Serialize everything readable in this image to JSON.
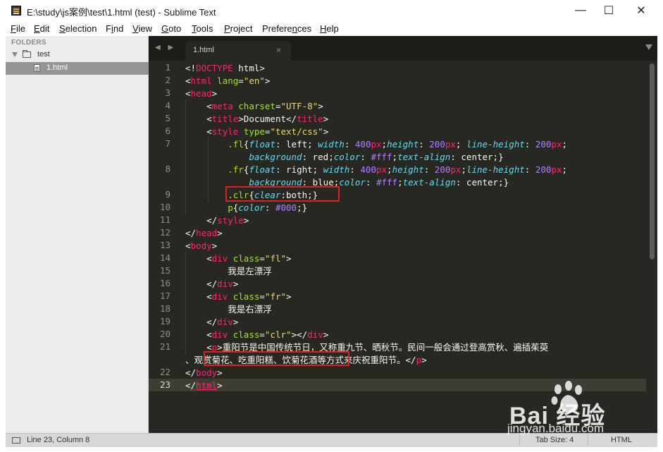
{
  "window": {
    "title": "E:\\study\\js案例\\test\\1.html (test) - Sublime Text",
    "controls": {
      "minimize": "—",
      "maximize": "☐",
      "close": "✕"
    }
  },
  "menu": [
    {
      "pre": "",
      "mn": "F",
      "post": "ile"
    },
    {
      "pre": "",
      "mn": "E",
      "post": "dit"
    },
    {
      "pre": "",
      "mn": "S",
      "post": "election"
    },
    {
      "pre": "F",
      "mn": "i",
      "post": "nd"
    },
    {
      "pre": "",
      "mn": "V",
      "post": "iew"
    },
    {
      "pre": "",
      "mn": "G",
      "post": "oto"
    },
    {
      "pre": "",
      "mn": "T",
      "post": "ools"
    },
    {
      "pre": "",
      "mn": "P",
      "post": "roject"
    },
    {
      "pre": "Prefere",
      "mn": "n",
      "post": "ces"
    },
    {
      "pre": "",
      "mn": "H",
      "post": "elp"
    }
  ],
  "sidebar": {
    "header": "FOLDERS",
    "folder": "test",
    "file": "1.html"
  },
  "tabs": {
    "nav": "◀ ▶",
    "active_tab": "1.html",
    "close": "×"
  },
  "editor": {
    "line_numbers": [
      "1",
      "2",
      "3",
      "4",
      "5",
      "6",
      "7",
      "",
      "8",
      "",
      "9",
      "10",
      "11",
      "12",
      "13",
      "14",
      "15",
      "16",
      "17",
      "18",
      "19",
      "20",
      "21",
      "",
      "22",
      "23"
    ],
    "active_line": "23",
    "code": [
      [
        [
          "t",
          "<!"
        ],
        [
          "k",
          "DOCTYPE"
        ],
        [
          "t",
          " html>"
        ]
      ],
      [
        [
          "t",
          "<"
        ],
        [
          "k",
          "html"
        ],
        [
          "t",
          " "
        ],
        [
          "a",
          "lang"
        ],
        [
          "t",
          "="
        ],
        [
          "s",
          "\"en\""
        ],
        [
          "t",
          ">"
        ]
      ],
      [
        [
          "t",
          "<"
        ],
        [
          "k",
          "head"
        ],
        [
          "t",
          ">"
        ]
      ],
      [
        [
          "t",
          "    <"
        ],
        [
          "k",
          "meta"
        ],
        [
          "t",
          " "
        ],
        [
          "a",
          "charset"
        ],
        [
          "t",
          "="
        ],
        [
          "s",
          "\"UTF-8\""
        ],
        [
          "t",
          ">"
        ]
      ],
      [
        [
          "t",
          "    <"
        ],
        [
          "k",
          "title"
        ],
        [
          "t",
          ">Document</"
        ],
        [
          "k",
          "title"
        ],
        [
          "t",
          ">"
        ]
      ],
      [
        [
          "t",
          "    <"
        ],
        [
          "k",
          "style"
        ],
        [
          "t",
          " "
        ],
        [
          "a",
          "type"
        ],
        [
          "t",
          "="
        ],
        [
          "s",
          "\"text/css\""
        ],
        [
          "t",
          ">"
        ]
      ],
      [
        [
          "t",
          "        "
        ],
        [
          "a",
          ".fl"
        ],
        [
          "t",
          "{"
        ],
        [
          "p",
          "float"
        ],
        [
          "t",
          ": left; "
        ],
        [
          "p",
          "width"
        ],
        [
          "t",
          ": "
        ],
        [
          "n",
          "400"
        ],
        [
          "k",
          "px"
        ],
        [
          "t",
          ";"
        ],
        [
          "p",
          "height"
        ],
        [
          "t",
          ": "
        ],
        [
          "n",
          "200"
        ],
        [
          "k",
          "px"
        ],
        [
          "t",
          "; "
        ],
        [
          "p",
          "line-height"
        ],
        [
          "t",
          ": "
        ],
        [
          "n",
          "200"
        ],
        [
          "k",
          "px"
        ],
        [
          "t",
          ";"
        ]
      ],
      [
        [
          "t",
          "            "
        ],
        [
          "p",
          "background"
        ],
        [
          "t",
          ": red;"
        ],
        [
          "p",
          "color"
        ],
        [
          "t",
          ": "
        ],
        [
          "n",
          "#fff"
        ],
        [
          "t",
          ";"
        ],
        [
          "p",
          "text-align"
        ],
        [
          "t",
          ": center;}"
        ]
      ],
      [
        [
          "t",
          "        "
        ],
        [
          "a",
          ".fr"
        ],
        [
          "t",
          "{"
        ],
        [
          "p",
          "float"
        ],
        [
          "t",
          ": right; "
        ],
        [
          "p",
          "width"
        ],
        [
          "t",
          ": "
        ],
        [
          "n",
          "400"
        ],
        [
          "k",
          "px"
        ],
        [
          "t",
          ";"
        ],
        [
          "p",
          "height"
        ],
        [
          "t",
          ": "
        ],
        [
          "n",
          "200"
        ],
        [
          "k",
          "px"
        ],
        [
          "t",
          ";"
        ],
        [
          "p",
          "line-height"
        ],
        [
          "t",
          ": "
        ],
        [
          "n",
          "200"
        ],
        [
          "k",
          "px"
        ],
        [
          "t",
          ";"
        ]
      ],
      [
        [
          "t",
          "            "
        ],
        [
          "p",
          "background"
        ],
        [
          "t",
          ": blue;"
        ],
        [
          "p",
          "color"
        ],
        [
          "t",
          ": "
        ],
        [
          "n",
          "#fff"
        ],
        [
          "t",
          ";"
        ],
        [
          "p",
          "text-align"
        ],
        [
          "t",
          ": center;}"
        ]
      ],
      [
        [
          "t",
          "        "
        ],
        [
          "a",
          ".clr"
        ],
        [
          "t",
          "{"
        ],
        [
          "p",
          "clear"
        ],
        [
          "t",
          ":both;}"
        ]
      ],
      [
        [
          "t",
          "        "
        ],
        [
          "a",
          "p"
        ],
        [
          "t",
          "{"
        ],
        [
          "p",
          "color"
        ],
        [
          "t",
          ": "
        ],
        [
          "n",
          "#000"
        ],
        [
          "t",
          ";}"
        ]
      ],
      [
        [
          "t",
          "    </"
        ],
        [
          "k",
          "style"
        ],
        [
          "t",
          ">"
        ]
      ],
      [
        [
          "t",
          "</"
        ],
        [
          "k",
          "head"
        ],
        [
          "t",
          ">"
        ]
      ],
      [
        [
          "t",
          "<"
        ],
        [
          "k",
          "body"
        ],
        [
          "t",
          ">"
        ]
      ],
      [
        [
          "t",
          "    <"
        ],
        [
          "k",
          "div"
        ],
        [
          "t",
          " "
        ],
        [
          "a",
          "class"
        ],
        [
          "t",
          "="
        ],
        [
          "s",
          "\"fl\""
        ],
        [
          "t",
          ">"
        ]
      ],
      [
        [
          "t",
          "        我是左漂浮"
        ]
      ],
      [
        [
          "t",
          "    </"
        ],
        [
          "k",
          "div"
        ],
        [
          "t",
          ">"
        ]
      ],
      [
        [
          "t",
          "    <"
        ],
        [
          "k",
          "div"
        ],
        [
          "t",
          " "
        ],
        [
          "a",
          "class"
        ],
        [
          "t",
          "="
        ],
        [
          "s",
          "\"fr\""
        ],
        [
          "t",
          ">"
        ]
      ],
      [
        [
          "t",
          "        我是右漂浮"
        ]
      ],
      [
        [
          "t",
          "    </"
        ],
        [
          "k",
          "div"
        ],
        [
          "t",
          ">"
        ]
      ],
      [
        [
          "t",
          "    <"
        ],
        [
          "k",
          "div"
        ],
        [
          "t",
          " "
        ],
        [
          "a",
          "class"
        ],
        [
          "t",
          "="
        ],
        [
          "s",
          "\"clr\""
        ],
        [
          "t",
          "></"
        ],
        [
          "k",
          "div"
        ],
        [
          "t",
          ">"
        ]
      ],
      [
        [
          "t",
          "    <"
        ],
        [
          "k",
          "p"
        ],
        [
          "t",
          ">重阳节是中国传统节日，又称重九节、晒秋节。民间一般会通过登高赏秋、遍插茱萸"
        ]
      ],
      [
        [
          "t",
          "、观赏菊花、吃重阳糕、饮菊花酒等方式来庆祝重阳节。</"
        ],
        [
          "k",
          "p"
        ],
        [
          "t",
          ">"
        ]
      ],
      [
        [
          "t",
          "</"
        ],
        [
          "k",
          "body"
        ],
        [
          "t",
          ">"
        ]
      ],
      [
        [
          "t",
          "</"
        ],
        [
          "k",
          "html"
        ],
        [
          "t",
          ">"
        ]
      ]
    ]
  },
  "status": {
    "position": "Line 23, Column 8",
    "tab_size": "Tab Size: 4",
    "syntax": "HTML"
  },
  "watermark": {
    "brand": "Bai  经验",
    "url": "jingyan.baidu.com"
  },
  "colors": {
    "editor_bg": "#272822",
    "tag": "#f92672",
    "attribute": "#a6e22e",
    "string": "#e6db74",
    "number": "#ae81ff",
    "property": "#66d9ef",
    "highlight_box": "#e02020"
  }
}
